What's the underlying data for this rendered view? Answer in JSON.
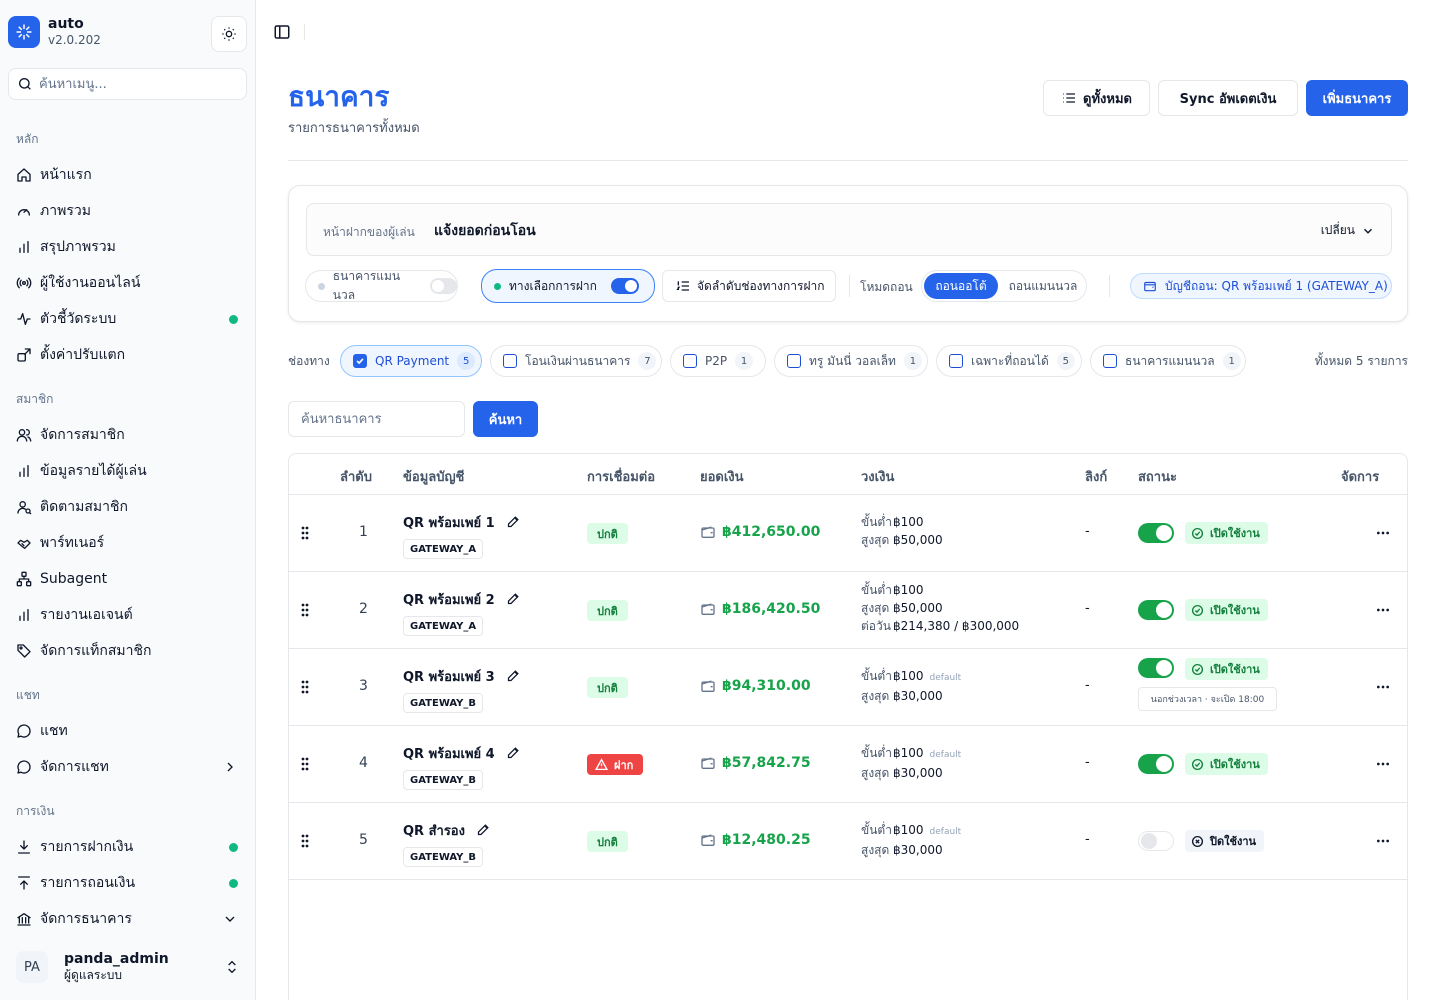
{
  "app": {
    "name": "auto",
    "version": "v2.0.202"
  },
  "sidebar": {
    "search_placeholder": "ค้นหาเมนู...",
    "groups": [
      {
        "label": "หลัก",
        "items": [
          {
            "label": "หน้าแรก",
            "icon": "home-icon"
          },
          {
            "label": "ภาพรวม",
            "icon": "gauge-icon"
          },
          {
            "label": "สรุปภาพรวม",
            "icon": "bar-chart-icon"
          },
          {
            "label": "ผู้ใช้งานออนไลน์",
            "icon": "radio-icon"
          },
          {
            "label": "ตัวชี้วัดระบบ",
            "icon": "activity-icon",
            "dot": true
          },
          {
            "label": "ตั้งค่าปรับแตก",
            "icon": "settings-icon"
          }
        ]
      },
      {
        "label": "สมาชิก",
        "items": [
          {
            "label": "จัดการสมาชิก",
            "icon": "users-icon"
          },
          {
            "label": "ข้อมูลรายได้ผู้เล่น",
            "icon": "bar-chart-icon"
          },
          {
            "label": "ติดตามสมาชิก",
            "icon": "user-search-icon"
          },
          {
            "label": "พาร์ทเนอร์",
            "icon": "handshake-icon"
          },
          {
            "label": "Subagent",
            "icon": "network-icon"
          },
          {
            "label": "รายงานเอเจนต์",
            "icon": "bar-chart-icon"
          },
          {
            "label": "จัดการแท็กสมาชิก",
            "icon": "tag-icon"
          }
        ]
      },
      {
        "label": "แชท",
        "items": [
          {
            "label": "แชท",
            "icon": "chat-icon"
          },
          {
            "label": "จัดการแชท",
            "icon": "chat-icon",
            "chevron": "right"
          }
        ]
      },
      {
        "label": "การเงิน",
        "items": [
          {
            "label": "รายการฝากเงิน",
            "icon": "download-icon",
            "dot": true
          },
          {
            "label": "รายการถอนเงิน",
            "icon": "upload-icon",
            "dot": true
          },
          {
            "label": "จัดการธนาคาร",
            "icon": "bank-icon",
            "chevron": "down"
          }
        ]
      }
    ]
  },
  "user": {
    "initials": "PA",
    "name": "panda_admin",
    "role": "ผู้ดูแลระบบ"
  },
  "header": {
    "title": "ธนาคาร",
    "subtitle": "รายการธนาคารทั้งหมด",
    "view_all_label": "ดูทั้งหมด",
    "sync_label": "Sync อัพเดตเงิน",
    "add_label": "เพิ่มธนาคาร"
  },
  "settings": {
    "player_deposit_label": "หน้าฝากของผู้เล่น",
    "player_deposit_value": "แจ้งยอดก่อนโอน",
    "change_label": "เปลี่ยน",
    "manual_bank_label": "ธนาคารแมนนวล",
    "manual_bank_on": false,
    "deposit_options_label": "ทางเลือกการฝาก",
    "deposit_options_on": true,
    "sort_channels_label": "จัดลำดับช่องทางการฝาก",
    "withdraw_mode_label": "โหมดถอน",
    "withdraw_auto_label": "ถอนออโต้",
    "withdraw_manual_label": "ถอนแมนนวล",
    "withdraw_account_label": "บัญชีถอน: QR พร้อมเพย์ 1 (GATEWAY_A)"
  },
  "channels": {
    "label": "ช่องทาง",
    "total_label": "ทั้งหมด 5 รายการ",
    "items": [
      {
        "label": "QR Payment",
        "count": "5",
        "checked": true
      },
      {
        "label": "โอนเงินผ่านธนาคาร",
        "count": "7",
        "checked": false
      },
      {
        "label": "P2P",
        "count": "1",
        "checked": false
      },
      {
        "label": "ทรู มันนี่ วอลเล็ท",
        "count": "1",
        "checked": false
      },
      {
        "label": "เฉพาะที่ถอนได้",
        "count": "5",
        "checked": false
      },
      {
        "label": "ธนาคารแมนนวล",
        "count": "1",
        "checked": false
      }
    ]
  },
  "search": {
    "placeholder": "ค้นหาธนาคาร",
    "button_label": "ค้นหา"
  },
  "table": {
    "headers": {
      "seq": "ลำดับ",
      "account": "ข้อมูลบัญชี",
      "connection": "การเชื่อมต่อ",
      "balance": "ยอดเงิน",
      "limits": "วงเงิน",
      "link": "ลิงก์",
      "status": "สถานะ",
      "actions": "จัดการ"
    },
    "limit_labels": {
      "min": "ขั้นต่ำ",
      "max": "สูงสุด",
      "daily": "ต่อวัน"
    },
    "rows": [
      {
        "seq": "1",
        "name": "QR พร้อมเพย์ 1",
        "gateway": "GATEWAY_A",
        "connection": "ปกติ",
        "connection_ok": true,
        "balance": "฿412,650.00",
        "min": "฿100",
        "min_default": "",
        "max": "฿50,000",
        "daily": "",
        "link": "-",
        "enabled": true,
        "status": "เปิดใช้งาน",
        "hours_note": ""
      },
      {
        "seq": "2",
        "name": "QR พร้อมเพย์ 2",
        "gateway": "GATEWAY_A",
        "connection": "ปกติ",
        "connection_ok": true,
        "balance": "฿186,420.50",
        "min": "฿100",
        "min_default": "",
        "max": "฿50,000",
        "daily": "฿214,380 / ฿300,000",
        "link": "-",
        "enabled": true,
        "status": "เปิดใช้งาน",
        "hours_note": ""
      },
      {
        "seq": "3",
        "name": "QR พร้อมเพย์ 3",
        "gateway": "GATEWAY_B",
        "connection": "ปกติ",
        "connection_ok": true,
        "balance": "฿94,310.00",
        "min": "฿100",
        "min_default": "default",
        "max": "฿30,000",
        "daily": "",
        "link": "-",
        "enabled": true,
        "status": "เปิดใช้งาน",
        "hours_note": "นอกช่วงเวลา · จะเปิด 18:00"
      },
      {
        "seq": "4",
        "name": "QR พร้อมเพย์ 4",
        "gateway": "GATEWAY_B",
        "connection": "ฝาก",
        "connection_ok": false,
        "balance": "฿57,842.75",
        "min": "฿100",
        "min_default": "default",
        "max": "฿30,000",
        "daily": "",
        "link": "-",
        "enabled": true,
        "status": "เปิดใช้งาน",
        "hours_note": ""
      },
      {
        "seq": "5",
        "name": "QR สำรอง",
        "gateway": "GATEWAY_B",
        "connection": "ปกติ",
        "connection_ok": true,
        "balance": "฿12,480.25",
        "min": "฿100",
        "min_default": "default",
        "max": "฿30,000",
        "daily": "",
        "link": "-",
        "enabled": false,
        "status": "ปิดใช้งาน",
        "hours_note": ""
      }
    ]
  },
  "colors": {
    "accent": "#2563eb",
    "success": "#16a34a",
    "danger": "#ef4444"
  }
}
